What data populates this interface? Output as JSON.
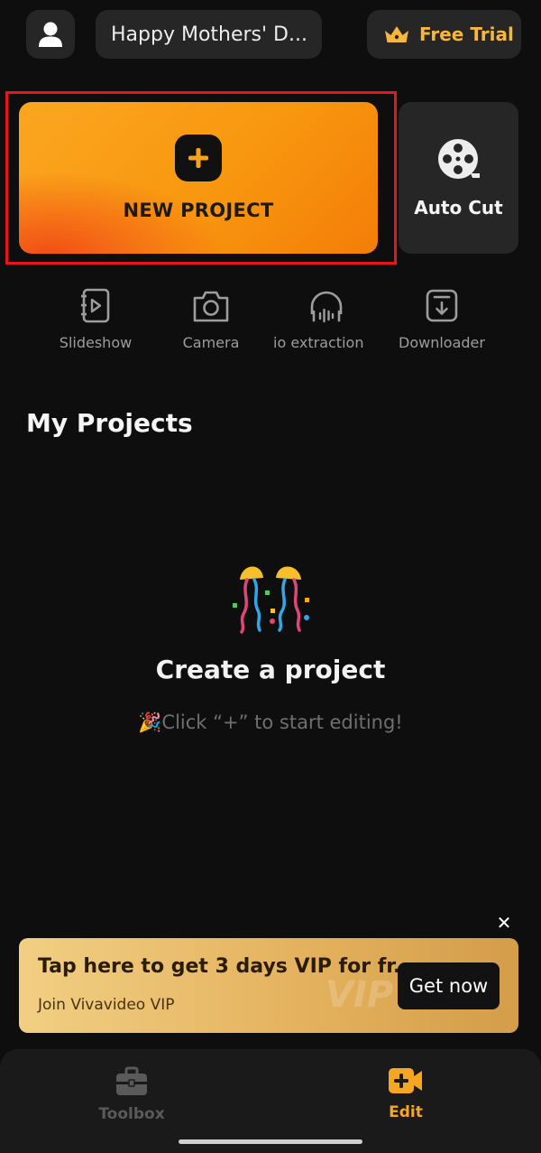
{
  "header": {
    "theme_pill": "Happy Mothers' D...",
    "trial_label": "Free Trial"
  },
  "hero": {
    "new_project_label": "NEW PROJECT",
    "auto_cut_label": "Auto Cut"
  },
  "tools": [
    {
      "label": "Slideshow",
      "icon": "slideshow-icon"
    },
    {
      "label": "Camera",
      "icon": "camera-icon"
    },
    {
      "label": "io extraction",
      "icon": "headphones-icon"
    },
    {
      "label": "Downloader",
      "icon": "download-icon"
    }
  ],
  "projects": {
    "section_title": "My Projects",
    "empty_title": "Create a project",
    "empty_subtitle": "🎉Click “+” to start editing!"
  },
  "banner": {
    "title": "Tap here to get 3 days VIP for fr...",
    "subtitle": "Join Vivavideo VIP",
    "watermark": "VIP",
    "cta_label": "Get now"
  },
  "bottom_nav": {
    "items": [
      {
        "label": "Toolbox",
        "active": false,
        "icon": "toolbox-icon"
      },
      {
        "label": "Edit",
        "active": true,
        "icon": "video-add-icon"
      }
    ]
  },
  "colors": {
    "accent": "#f6b73c",
    "highlight_box": "#e8161b",
    "background": "#0e0e0e"
  }
}
